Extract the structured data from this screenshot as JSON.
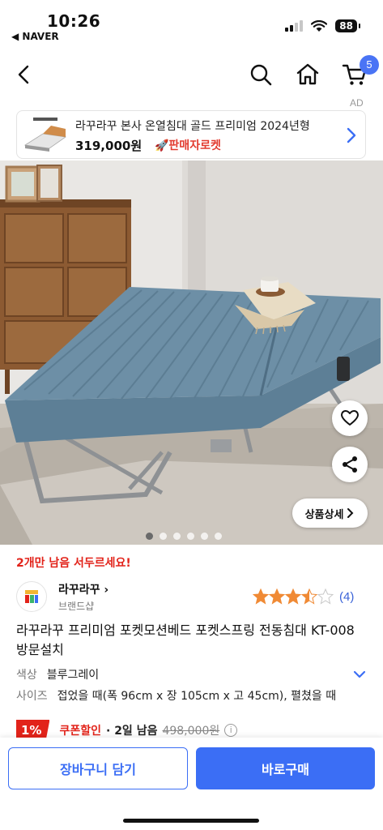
{
  "status_bar": {
    "time": "10:26",
    "back_app": "◀ NAVER",
    "battery": "88",
    "icons": [
      "signal-icon",
      "wifi-icon",
      "battery-icon"
    ]
  },
  "nav": {
    "icons": [
      "back-arrow-icon",
      "search-icon",
      "home-icon",
      "cart-icon"
    ],
    "cart_count": "5"
  },
  "ad": {
    "label": "AD",
    "title": "라꾸라꾸 본사 온열침대 골드 프리미엄 2024년형",
    "price": "319,000원",
    "rocket_label": "🚀판매자로켓"
  },
  "product_image": {
    "detail_button": "상품상세",
    "slide_count": 6,
    "active_slide": 0,
    "icons": [
      "heart-icon",
      "share-icon",
      "chevron-right-icon"
    ]
  },
  "info": {
    "urgency": "2개만 남음 서두르세요!",
    "brand_name": "라꾸라꾸",
    "brand_sub": "브랜드샵",
    "rating_stars": 4.5,
    "rating_count": "(4)",
    "title": "라꾸라꾸 프리미엄 포켓모션베드 포켓스프링 전동침대 KT-008 방문설치",
    "options": {
      "color_label": "색상",
      "color_value": "블루그레이",
      "size_label": "사이즈",
      "size_value": "접었을 때(폭 96cm x 장 105cm x 고 45cm), 펼쳤을 때"
    },
    "coupon": {
      "percent": "1%",
      "label": "쿠폰할인",
      "days_left": "· 2일 남음",
      "original_price": "498,000원"
    }
  },
  "bottom_bar": {
    "cart_button": "장바구니 담기",
    "buy_button": "바로구매"
  },
  "colors": {
    "accent_blue": "#3b6ef5",
    "alert_red": "#e2231a",
    "star_orange": "#f08a35",
    "mattress_blue": "#6d8fa6"
  }
}
